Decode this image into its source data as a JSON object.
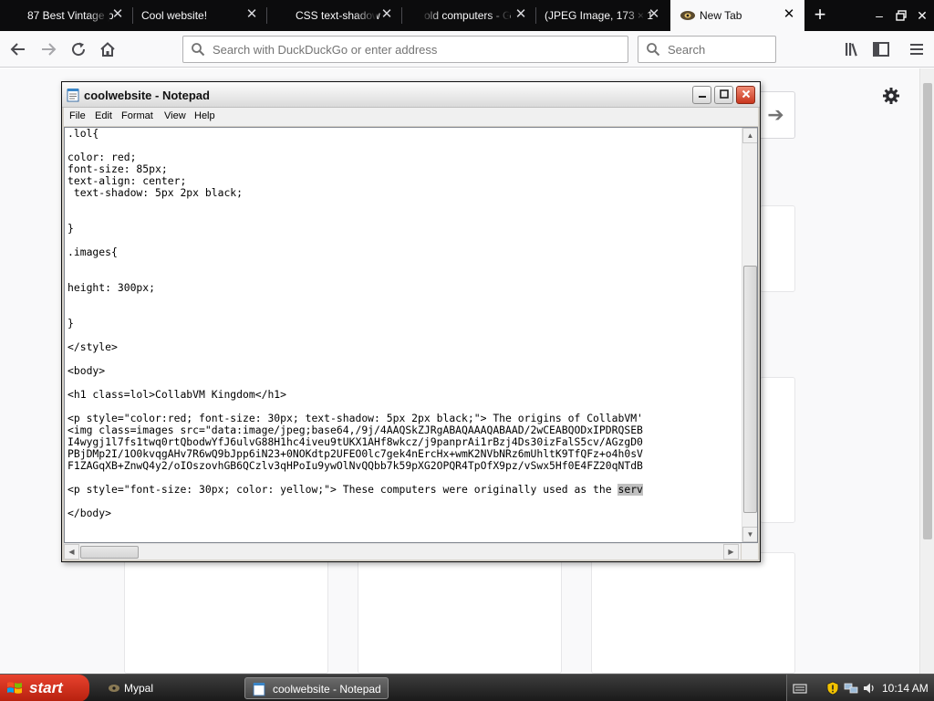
{
  "browser": {
    "tabs": [
      {
        "label": "87 Best Vintage p"
      },
      {
        "label": "Cool website!"
      },
      {
        "label": "CSS text-shadow"
      },
      {
        "label": "old computers - G"
      },
      {
        "label": "(JPEG Image, 173 × 1"
      },
      {
        "label": "New Tab"
      }
    ],
    "url_placeholder": "Search with DuckDuckGo or enter address",
    "search_placeholder": "Search"
  },
  "notepad": {
    "title": "coolwebsite - Notepad",
    "menu": [
      "File",
      "Edit",
      "Format",
      "View",
      "Help"
    ],
    "lines": [
      ".lol{",
      "",
      "color: red;",
      "font-size: 85px;",
      "text-align: center;",
      " text-shadow: 5px 2px black;",
      "",
      "",
      "}",
      "",
      ".images{",
      "",
      "",
      "height: 300px;",
      "",
      "",
      "}",
      "",
      "</style>",
      "",
      "<body>",
      "",
      "<h1 class=lol>CollabVM Kingdom</h1>",
      "",
      "<p style=\"color:red; font-size: 30px; text-shadow: 5px 2px black;\"> The origins of CollabVM'",
      "<img class=images src=\"data:image/jpeg;base64,/9j/4AAQSkZJRgABAQAAAQABAAD/2wCEABQODxIPDRQSEB",
      "I4wygj1l7fs1twq0rtQbodwYfJ6ulvG88H1hc4iveu9tUKX1AHf8wkcz/j9panprAi1rBzj4Ds30izFalS5cv/AGzgD0",
      "PBjDMp2I/1O0kvqgAHv7R6wQ9bJpp6iN23+0NOKdtp2UFEO0lc7gek4nErcHx+wmK2NVbNRz6mUhltK9TfQFz+o4h0sV",
      "F1ZAGqXB+ZnwQ4y2/oIOszovhGB6QCzlv3qHPoIu9ywOlNvQQbb7k59pXG2OPQR4TpOfX9pz/vSwx5Hf0E4FZ20qNTdB",
      "",
      "<p style=\"font-size: 30px; color: yellow;\"> These computers were originally used as the ",
      "",
      "</body>"
    ],
    "selected_text": "serv"
  },
  "taskbar": {
    "start_label": "start",
    "tasks": [
      {
        "label": "Mypal"
      },
      {
        "label": "coolwebsite - Notepad"
      }
    ],
    "clock": "10:14 AM"
  },
  "colors": {
    "tab_strip": "#0c0c0d",
    "active_tab": "#f9f9fa",
    "start_button": "#c8321c",
    "notepad_close": "#c9361e"
  }
}
